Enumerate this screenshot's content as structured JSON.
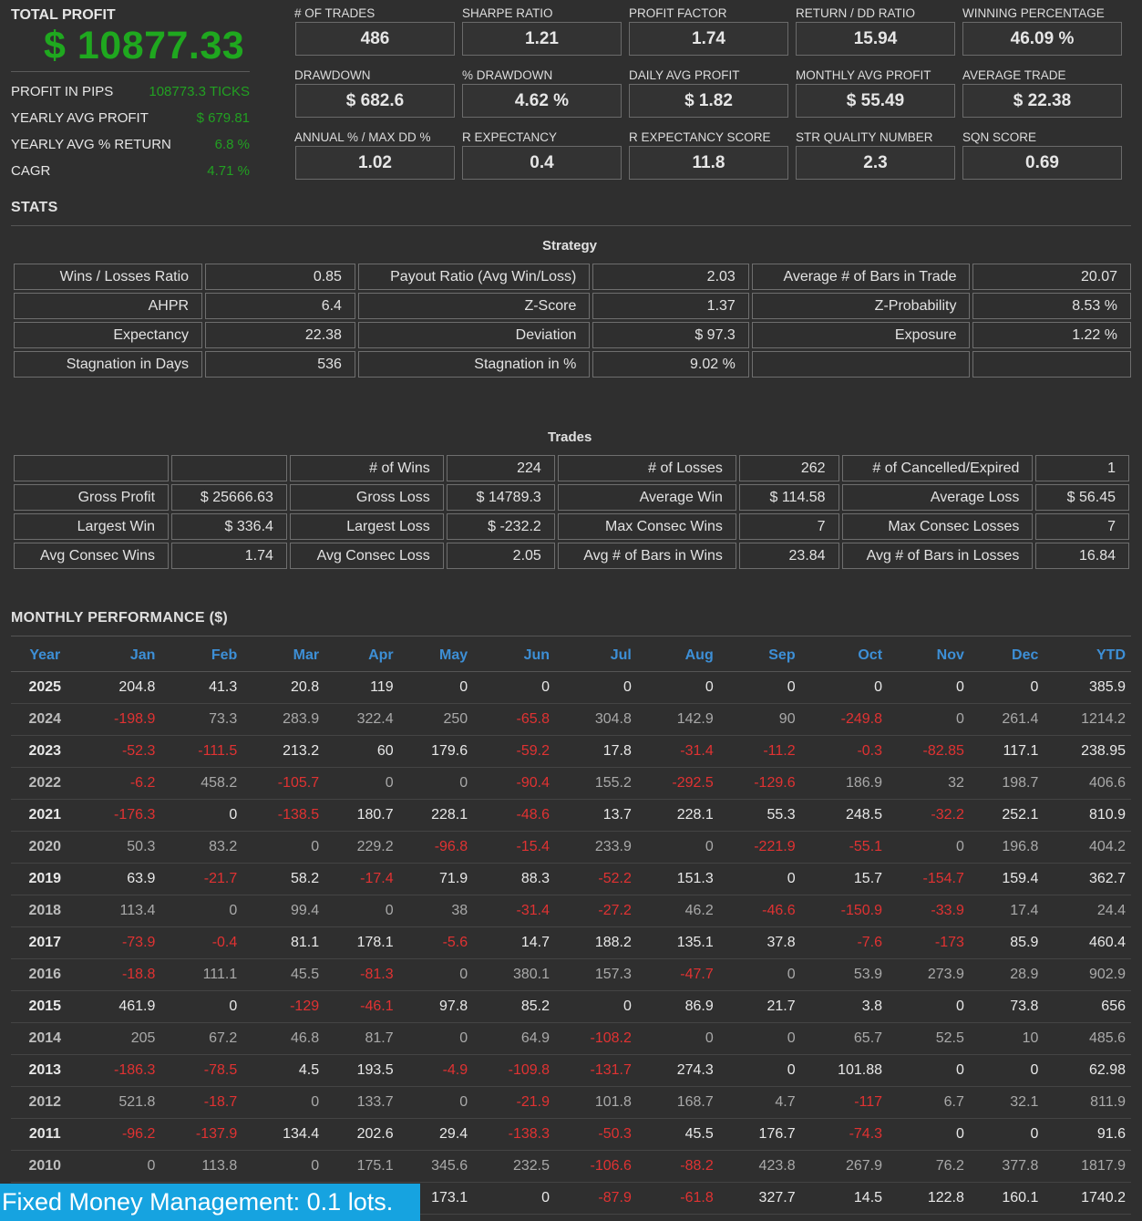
{
  "summary": {
    "title": "TOTAL PROFIT",
    "value": "$ 10877.33",
    "rows": [
      {
        "label": "PROFIT IN PIPS",
        "value": "108773.3 TICKS"
      },
      {
        "label": "YEARLY AVG PROFIT",
        "value": "$ 679.81"
      },
      {
        "label": "YEARLY AVG % RETURN",
        "value": "6.8 %"
      },
      {
        "label": "CAGR",
        "value": "4.71 %"
      }
    ]
  },
  "metrics": [
    {
      "label": "# OF TRADES",
      "value": "486"
    },
    {
      "label": "SHARPE RATIO",
      "value": "1.21"
    },
    {
      "label": "PROFIT FACTOR",
      "value": "1.74"
    },
    {
      "label": "RETURN / DD RATIO",
      "value": "15.94"
    },
    {
      "label": "WINNING PERCENTAGE",
      "value": "46.09 %"
    },
    {
      "label": "DRAWDOWN",
      "value": "$ 682.6"
    },
    {
      "label": "% DRAWDOWN",
      "value": "4.62 %"
    },
    {
      "label": "DAILY AVG PROFIT",
      "value": "$ 1.82"
    },
    {
      "label": "MONTHLY AVG PROFIT",
      "value": "$ 55.49"
    },
    {
      "label": "AVERAGE TRADE",
      "value": "$ 22.38"
    },
    {
      "label": "ANNUAL % / MAX DD %",
      "value": "1.02"
    },
    {
      "label": "R EXPECTANCY",
      "value": "0.4"
    },
    {
      "label": "R EXPECTANCY SCORE",
      "value": "11.8"
    },
    {
      "label": "STR QUALITY NUMBER",
      "value": "2.3"
    },
    {
      "label": "SQN SCORE",
      "value": "0.69"
    }
  ],
  "stats_heading": "STATS",
  "strategy": {
    "heading": "Strategy",
    "rows": [
      [
        "Wins / Losses Ratio",
        "0.85",
        "Payout Ratio (Avg Win/Loss)",
        "2.03",
        "Average # of Bars in Trade",
        "20.07"
      ],
      [
        "AHPR",
        "6.4",
        "Z-Score",
        "1.37",
        "Z-Probability",
        "8.53 %"
      ],
      [
        "Expectancy",
        "22.38",
        "Deviation",
        "$ 97.3",
        "Exposure",
        "1.22 %"
      ],
      [
        "Stagnation in Days",
        "536",
        "Stagnation in %",
        "9.02 %",
        "",
        ""
      ]
    ]
  },
  "trades": {
    "heading": "Trades",
    "rows": [
      [
        "",
        "",
        "# of Wins",
        "224",
        "# of Losses",
        "262",
        "# of Cancelled/Expired",
        "1"
      ],
      [
        "Gross Profit",
        "$ 25666.63",
        "Gross Loss",
        "$ 14789.3",
        "Average Win",
        "$ 114.58",
        "Average Loss",
        "$ 56.45"
      ],
      [
        "Largest Win",
        "$ 336.4",
        "Largest Loss",
        "$ -232.2",
        "Max Consec Wins",
        "7",
        "Max Consec Losses",
        "7"
      ],
      [
        "Avg Consec Wins",
        "1.74",
        "Avg Consec Loss",
        "2.05",
        "Avg # of Bars in Wins",
        "23.84",
        "Avg # of Bars in Losses",
        "16.84"
      ]
    ]
  },
  "monthly": {
    "heading": "MONTHLY PERFORMANCE ($)",
    "columns": [
      "Year",
      "Jan",
      "Feb",
      "Mar",
      "Apr",
      "May",
      "Jun",
      "Jul",
      "Aug",
      "Sep",
      "Oct",
      "Nov",
      "Dec",
      "YTD"
    ],
    "rows": [
      [
        "2025",
        "204.8",
        "41.3",
        "20.8",
        "119",
        "0",
        "0",
        "0",
        "0",
        "0",
        "0",
        "0",
        "0",
        "385.9"
      ],
      [
        "2024",
        "-198.9",
        "73.3",
        "283.9",
        "322.4",
        "250",
        "-65.8",
        "304.8",
        "142.9",
        "90",
        "-249.8",
        "0",
        "261.4",
        "1214.2"
      ],
      [
        "2023",
        "-52.3",
        "-111.5",
        "213.2",
        "60",
        "179.6",
        "-59.2",
        "17.8",
        "-31.4",
        "-11.2",
        "-0.3",
        "-82.85",
        "117.1",
        "238.95"
      ],
      [
        "2022",
        "-6.2",
        "458.2",
        "-105.7",
        "0",
        "0",
        "-90.4",
        "155.2",
        "-292.5",
        "-129.6",
        "186.9",
        "32",
        "198.7",
        "406.6"
      ],
      [
        "2021",
        "-176.3",
        "0",
        "-138.5",
        "180.7",
        "228.1",
        "-48.6",
        "13.7",
        "228.1",
        "55.3",
        "248.5",
        "-32.2",
        "252.1",
        "810.9"
      ],
      [
        "2020",
        "50.3",
        "83.2",
        "0",
        "229.2",
        "-96.8",
        "-15.4",
        "233.9",
        "0",
        "-221.9",
        "-55.1",
        "0",
        "196.8",
        "404.2"
      ],
      [
        "2019",
        "63.9",
        "-21.7",
        "58.2",
        "-17.4",
        "71.9",
        "88.3",
        "-52.2",
        "151.3",
        "0",
        "15.7",
        "-154.7",
        "159.4",
        "362.7"
      ],
      [
        "2018",
        "113.4",
        "0",
        "99.4",
        "0",
        "38",
        "-31.4",
        "-27.2",
        "46.2",
        "-46.6",
        "-150.9",
        "-33.9",
        "17.4",
        "24.4"
      ],
      [
        "2017",
        "-73.9",
        "-0.4",
        "81.1",
        "178.1",
        "-5.6",
        "14.7",
        "188.2",
        "135.1",
        "37.8",
        "-7.6",
        "-173",
        "85.9",
        "460.4"
      ],
      [
        "2016",
        "-18.8",
        "111.1",
        "45.5",
        "-81.3",
        "0",
        "380.1",
        "157.3",
        "-47.7",
        "0",
        "53.9",
        "273.9",
        "28.9",
        "902.9"
      ],
      [
        "2015",
        "461.9",
        "0",
        "-129",
        "-46.1",
        "97.8",
        "85.2",
        "0",
        "86.9",
        "21.7",
        "3.8",
        "0",
        "73.8",
        "656"
      ],
      [
        "2014",
        "205",
        "67.2",
        "46.8",
        "81.7",
        "0",
        "64.9",
        "-108.2",
        "0",
        "0",
        "65.7",
        "52.5",
        "10",
        "485.6"
      ],
      [
        "2013",
        "-186.3",
        "-78.5",
        "4.5",
        "193.5",
        "-4.9",
        "-109.8",
        "-131.7",
        "274.3",
        "0",
        "101.88",
        "0",
        "0",
        "62.98"
      ],
      [
        "2012",
        "521.8",
        "-18.7",
        "0",
        "133.7",
        "0",
        "-21.9",
        "101.8",
        "168.7",
        "4.7",
        "-117",
        "6.7",
        "32.1",
        "811.9"
      ],
      [
        "2011",
        "-96.2",
        "-137.9",
        "134.4",
        "202.6",
        "29.4",
        "-138.3",
        "-50.3",
        "45.5",
        "176.7",
        "-74.3",
        "0",
        "0",
        "91.6"
      ],
      [
        "2010",
        "0",
        "113.8",
        "0",
        "175.1",
        "345.6",
        "232.5",
        "-106.6",
        "-88.2",
        "423.8",
        "267.9",
        "76.2",
        "377.8",
        "1817.9"
      ],
      [
        "",
        "",
        "",
        "",
        "",
        "173.1",
        "0",
        "-87.9",
        "-61.8",
        "327.7",
        "14.5",
        "122.8",
        "160.1",
        "1740.2"
      ]
    ]
  },
  "banner": "Fixed Money Management: 0.1 lots."
}
